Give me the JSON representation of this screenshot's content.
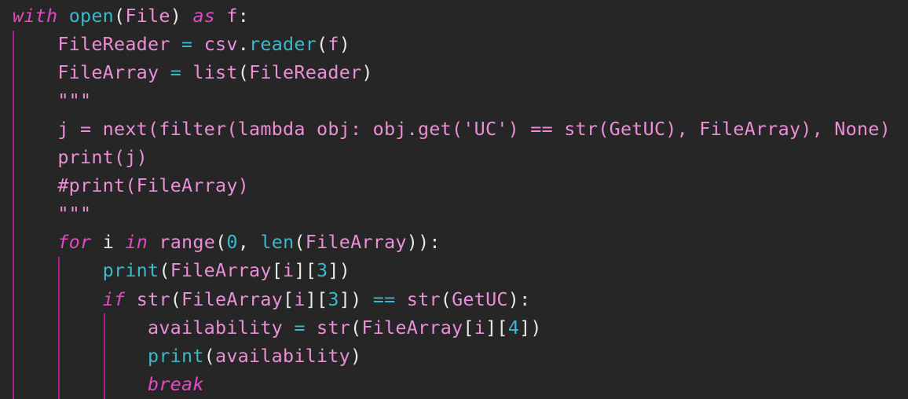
{
  "editor": {
    "language": "python",
    "colors": {
      "background": "#262626",
      "keyword": "#e04bc1",
      "function": "#3bb9cc",
      "identifier": "#ea8fd7",
      "punctuation": "#e7e7e7",
      "indent_guide": "#b01d84"
    },
    "lines": [
      [
        {
          "t": "with",
          "c": "kw"
        },
        {
          "t": " ",
          "c": "p"
        },
        {
          "t": "open",
          "c": "fn"
        },
        {
          "t": "(",
          "c": "p"
        },
        {
          "t": "File",
          "c": "id"
        },
        {
          "t": ") ",
          "c": "p"
        },
        {
          "t": "as",
          "c": "kw"
        },
        {
          "t": " ",
          "c": "p"
        },
        {
          "t": "f",
          "c": "id"
        },
        {
          "t": ":",
          "c": "p"
        }
      ],
      [
        {
          "t": "    ",
          "c": "p"
        },
        {
          "t": "FileReader",
          "c": "id"
        },
        {
          "t": " ",
          "c": "p"
        },
        {
          "t": "=",
          "c": "op"
        },
        {
          "t": " ",
          "c": "p"
        },
        {
          "t": "csv",
          "c": "id"
        },
        {
          "t": ".",
          "c": "p"
        },
        {
          "t": "reader",
          "c": "fn"
        },
        {
          "t": "(",
          "c": "p"
        },
        {
          "t": "f",
          "c": "id"
        },
        {
          "t": ")",
          "c": "p"
        }
      ],
      [
        {
          "t": "    ",
          "c": "p"
        },
        {
          "t": "FileArray",
          "c": "id"
        },
        {
          "t": " ",
          "c": "p"
        },
        {
          "t": "=",
          "c": "op"
        },
        {
          "t": " ",
          "c": "p"
        },
        {
          "t": "list",
          "c": "id"
        },
        {
          "t": "(",
          "c": "p"
        },
        {
          "t": "FileReader",
          "c": "id"
        },
        {
          "t": ")",
          "c": "p"
        }
      ],
      [
        {
          "t": "    ",
          "c": "p"
        },
        {
          "t": "\"\"\"",
          "c": "str"
        }
      ],
      [
        {
          "t": "    ",
          "c": "p"
        },
        {
          "t": "j = next(filter(lambda obj: obj.get('UC') == str(GetUC), FileArray), None)",
          "c": "str"
        }
      ],
      [
        {
          "t": "    ",
          "c": "p"
        },
        {
          "t": "print(j)",
          "c": "str"
        }
      ],
      [
        {
          "t": "    ",
          "c": "p"
        },
        {
          "t": "#print(FileArray)",
          "c": "str"
        }
      ],
      [
        {
          "t": "    ",
          "c": "p"
        },
        {
          "t": "\"\"\"",
          "c": "str"
        }
      ],
      [
        {
          "t": "    ",
          "c": "p"
        },
        {
          "t": "for",
          "c": "kw"
        },
        {
          "t": " ",
          "c": "p"
        },
        {
          "t": "i",
          "c": "plain"
        },
        {
          "t": " ",
          "c": "p"
        },
        {
          "t": "in",
          "c": "kw"
        },
        {
          "t": " ",
          "c": "p"
        },
        {
          "t": "range",
          "c": "id"
        },
        {
          "t": "(",
          "c": "p"
        },
        {
          "t": "0",
          "c": "num"
        },
        {
          "t": ", ",
          "c": "p"
        },
        {
          "t": "len",
          "c": "fn"
        },
        {
          "t": "(",
          "c": "p"
        },
        {
          "t": "FileArray",
          "c": "id"
        },
        {
          "t": ")):",
          "c": "p"
        }
      ],
      [
        {
          "t": "        ",
          "c": "p"
        },
        {
          "t": "print",
          "c": "fn"
        },
        {
          "t": "(",
          "c": "p"
        },
        {
          "t": "FileArray",
          "c": "id"
        },
        {
          "t": "[",
          "c": "p"
        },
        {
          "t": "i",
          "c": "id"
        },
        {
          "t": "][",
          "c": "p"
        },
        {
          "t": "3",
          "c": "num"
        },
        {
          "t": "])",
          "c": "p"
        }
      ],
      [
        {
          "t": "        ",
          "c": "p"
        },
        {
          "t": "if",
          "c": "kw"
        },
        {
          "t": " ",
          "c": "p"
        },
        {
          "t": "str",
          "c": "id"
        },
        {
          "t": "(",
          "c": "p"
        },
        {
          "t": "FileArray",
          "c": "id"
        },
        {
          "t": "[",
          "c": "p"
        },
        {
          "t": "i",
          "c": "id"
        },
        {
          "t": "][",
          "c": "p"
        },
        {
          "t": "3",
          "c": "num"
        },
        {
          "t": "]) ",
          "c": "p"
        },
        {
          "t": "==",
          "c": "op"
        },
        {
          "t": " ",
          "c": "p"
        },
        {
          "t": "str",
          "c": "id"
        },
        {
          "t": "(",
          "c": "p"
        },
        {
          "t": "GetUC",
          "c": "id"
        },
        {
          "t": "):",
          "c": "p"
        }
      ],
      [
        {
          "t": "            ",
          "c": "p"
        },
        {
          "t": "availability",
          "c": "id"
        },
        {
          "t": " ",
          "c": "p"
        },
        {
          "t": "=",
          "c": "op"
        },
        {
          "t": " ",
          "c": "p"
        },
        {
          "t": "str",
          "c": "id"
        },
        {
          "t": "(",
          "c": "p"
        },
        {
          "t": "FileArray",
          "c": "id"
        },
        {
          "t": "[",
          "c": "p"
        },
        {
          "t": "i",
          "c": "id"
        },
        {
          "t": "][",
          "c": "p"
        },
        {
          "t": "4",
          "c": "num"
        },
        {
          "t": "])",
          "c": "p"
        }
      ],
      [
        {
          "t": "            ",
          "c": "p"
        },
        {
          "t": "print",
          "c": "fn"
        },
        {
          "t": "(",
          "c": "p"
        },
        {
          "t": "availability",
          "c": "id"
        },
        {
          "t": ")",
          "c": "p"
        }
      ],
      [
        {
          "t": "            ",
          "c": "p"
        },
        {
          "t": "break",
          "c": "kw"
        }
      ]
    ]
  }
}
